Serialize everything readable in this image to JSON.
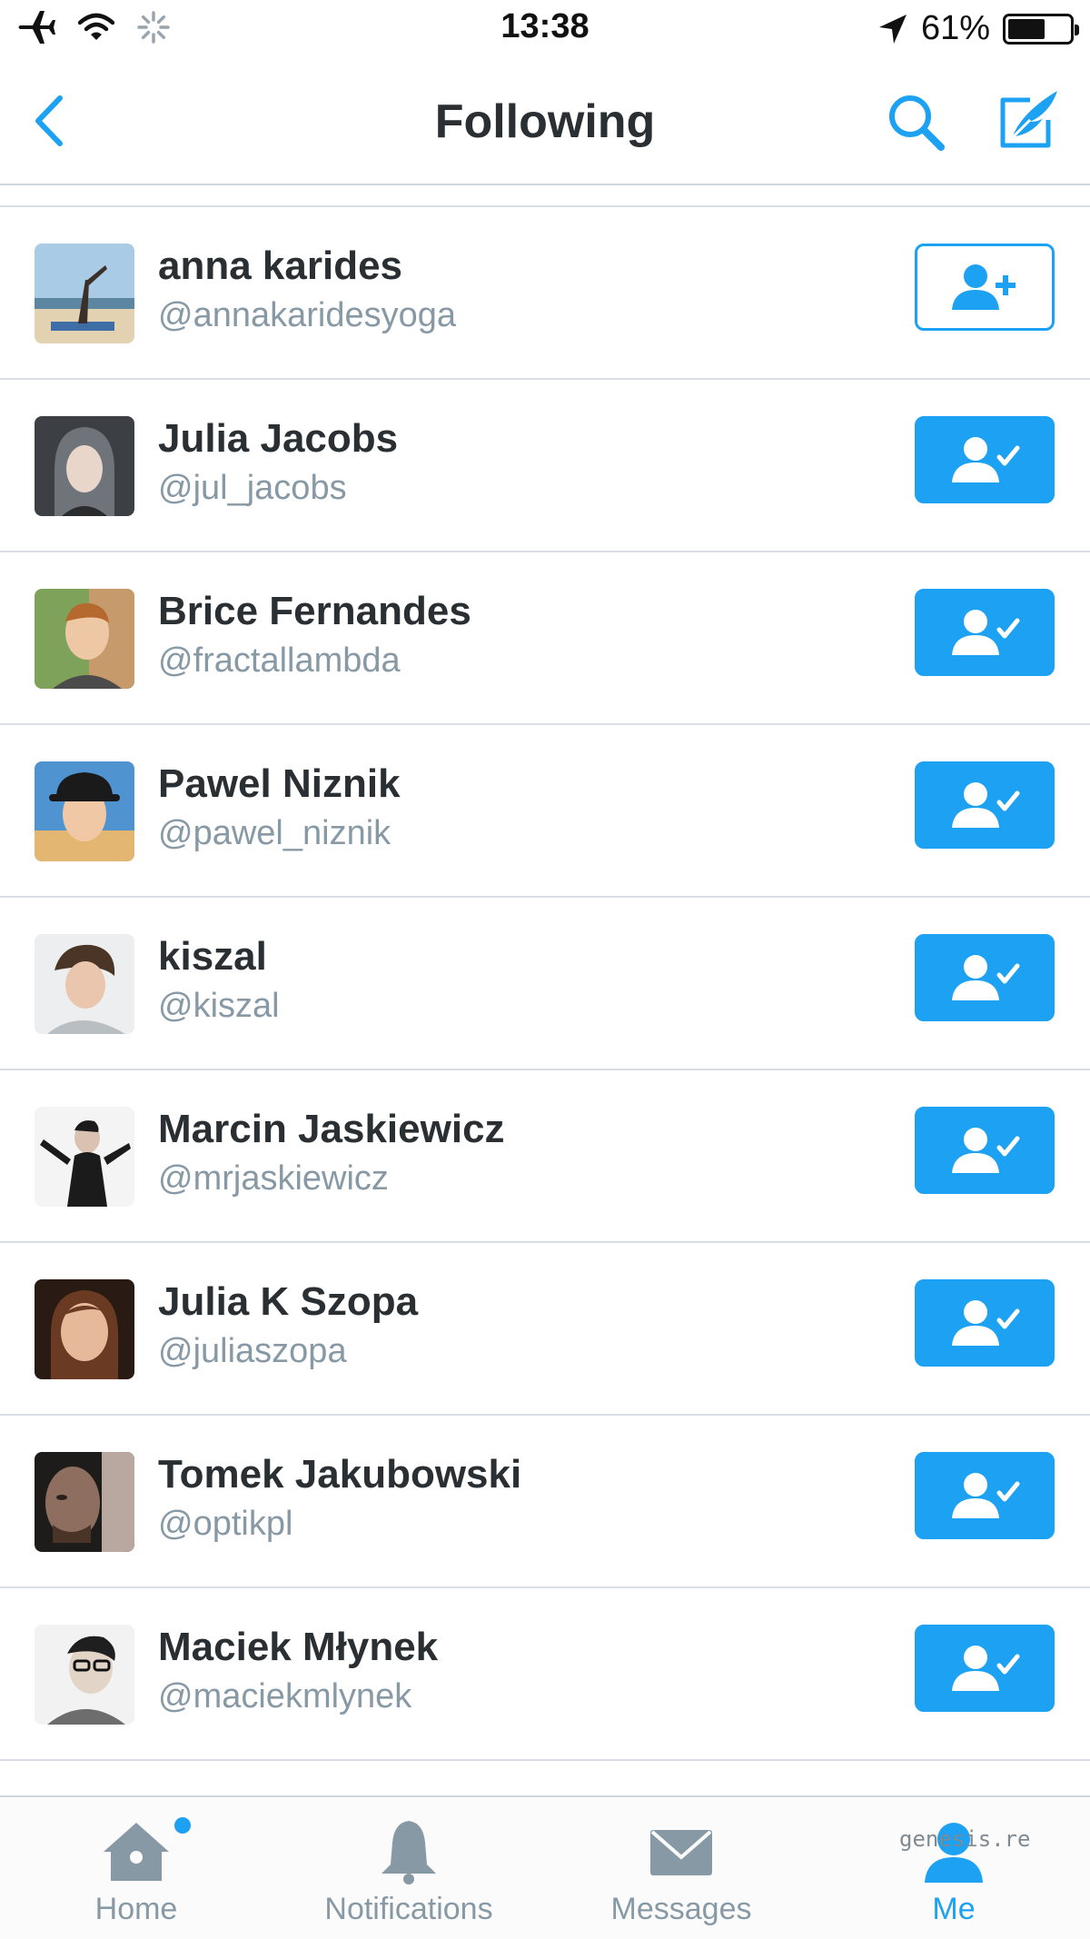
{
  "status_bar": {
    "time": "13:38",
    "battery_percent": "61%",
    "battery_level": 0.61,
    "icons": [
      "airplane-icon",
      "wifi-icon",
      "activity-spinner-icon",
      "location-arrow-icon",
      "battery-icon"
    ]
  },
  "nav": {
    "title": "Following",
    "back_icon": "chevron-left-icon",
    "search_icon": "search-icon",
    "compose_icon": "compose-icon"
  },
  "users": [
    {
      "name": "anna karides",
      "handle": "@annakaridesyoga",
      "following": false
    },
    {
      "name": "Julia Jacobs",
      "handle": "@jul_jacobs",
      "following": true
    },
    {
      "name": "Brice Fernandes",
      "handle": "@fractallambda",
      "following": true
    },
    {
      "name": "Pawel Niznik",
      "handle": "@pawel_niznik",
      "following": true
    },
    {
      "name": "kiszal",
      "handle": "@kiszal",
      "following": true
    },
    {
      "name": "Marcin Jaskiewicz",
      "handle": "@mrjaskiewicz",
      "following": true
    },
    {
      "name": "Julia K Szopa",
      "handle": "@juliaszopa",
      "following": true
    },
    {
      "name": "Tomek Jakubowski",
      "handle": "@optikpl",
      "following": true
    },
    {
      "name": "Maciek Młynek",
      "handle": "@maciekmlynek",
      "following": true
    }
  ],
  "tabs": [
    {
      "label": "Home",
      "icon": "home-icon",
      "active": false,
      "badge": true
    },
    {
      "label": "Notifications",
      "icon": "bell-icon",
      "active": false,
      "badge": false
    },
    {
      "label": "Messages",
      "icon": "envelope-icon",
      "active": false,
      "badge": false
    },
    {
      "label": "Me",
      "icon": "person-icon",
      "active": true,
      "badge": false
    }
  ],
  "watermark": "genesis.re",
  "colors": {
    "accent": "#1da1f2",
    "text": "#292f33",
    "secondary_text": "#8899a6",
    "separator": "#d8dee3"
  }
}
